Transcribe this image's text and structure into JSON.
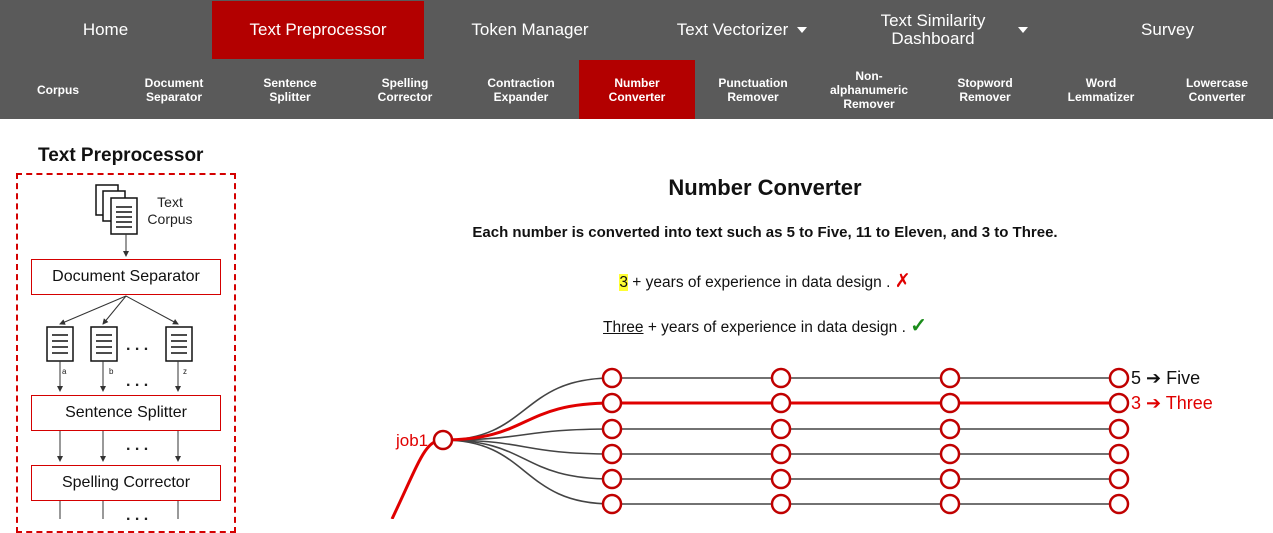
{
  "top_nav": [
    {
      "label": "Home"
    },
    {
      "label": "Text Preprocessor"
    },
    {
      "label": "Token Manager"
    },
    {
      "label": "Text Vectorizer"
    },
    {
      "label": "Text Similarity Dashboard"
    },
    {
      "label": "Survey"
    }
  ],
  "sub_nav": [
    {
      "label": "Corpus"
    },
    {
      "label": "Document Separator"
    },
    {
      "label": "Sentence Splitter"
    },
    {
      "label": "Spelling Corrector"
    },
    {
      "label": "Contraction Expander"
    },
    {
      "label": "Number Converter"
    },
    {
      "label": "Punctuation Remover"
    },
    {
      "label": "Non-alphanumeric Remover"
    },
    {
      "label": "Stopword Remover"
    },
    {
      "label": "Word Lemmatizer"
    },
    {
      "label": "Lowercase Converter"
    }
  ],
  "diagram": {
    "title": "Text Preprocessor",
    "corpus_label": "Text Corpus",
    "doc_labels": [
      "a",
      "b",
      "z"
    ],
    "ellipsis": ". . .",
    "steps": [
      "Document Separator",
      "Sentence Splitter",
      "Spelling Corrector"
    ]
  },
  "main": {
    "title": "Number Converter",
    "description": "Each number is converted into text such as 5 to Five, 11 to Eleven, and 3 to Three.",
    "example_before": {
      "highlight": "3",
      "rest": " + years of experience in data design .",
      "mark": "✗"
    },
    "example_after": {
      "underlined": "Three",
      "rest": " + years of experience in data design .",
      "mark": "✓"
    }
  },
  "network": {
    "source_label": "job1",
    "outputs": [
      {
        "text": "5 ➔ Five",
        "active": false
      },
      {
        "text": "3 ➔ Three",
        "active": true
      }
    ],
    "colors": {
      "active": "#e00000",
      "inactive": "#444444",
      "accent": "#b30000",
      "nav": "#5a5a5a"
    }
  }
}
